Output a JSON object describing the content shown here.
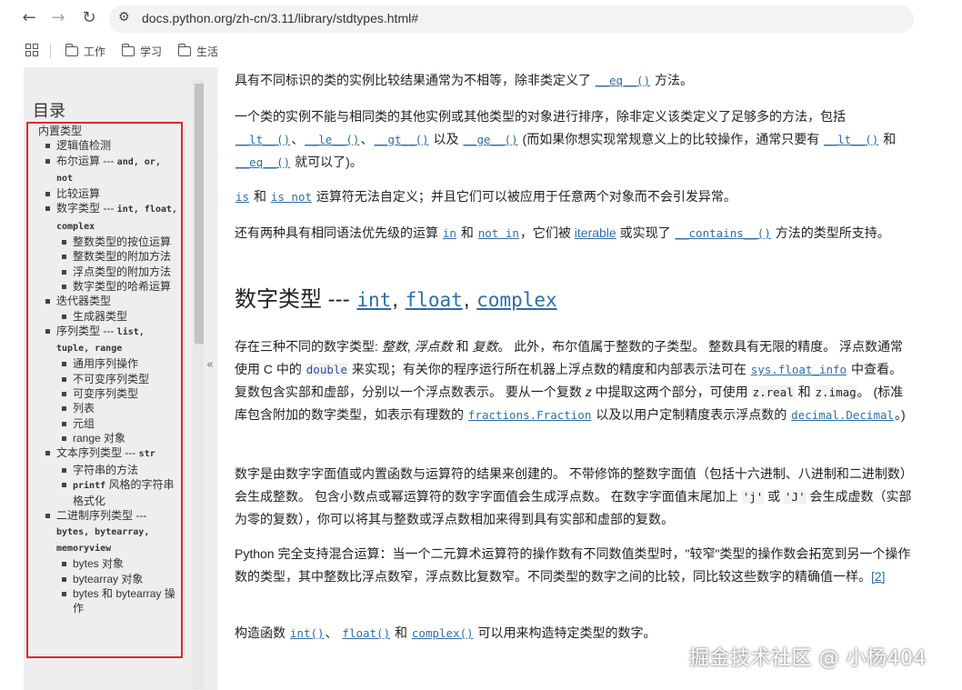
{
  "browser": {
    "back_icon": "←",
    "forward_icon": "→",
    "reload_icon": "↻",
    "url": "docs.python.org/zh-cn/3.11/library/stdtypes.html#",
    "bookmarks": [
      "工作",
      "学习",
      "生活"
    ]
  },
  "sidebar": {
    "title": "目录",
    "collapse_icon": "«",
    "toc": [
      {
        "level": 0,
        "text": "内置类型"
      },
      {
        "level": 1,
        "text": "逻辑值检测"
      },
      {
        "level": 1,
        "text": "布尔运算 --- ",
        "code": "and, or, not"
      },
      {
        "level": 1,
        "text": "比较运算"
      },
      {
        "level": 1,
        "text": "数字类型 --- ",
        "code": "int, float, complex"
      },
      {
        "level": 2,
        "text": "整数类型的按位运算"
      },
      {
        "level": 2,
        "text": "整数类型的附加方法"
      },
      {
        "level": 2,
        "text": "浮点类型的附加方法"
      },
      {
        "level": 2,
        "text": "数字类型的哈希运算"
      },
      {
        "level": 1,
        "text": "迭代器类型"
      },
      {
        "level": 2,
        "text": "生成器类型"
      },
      {
        "level": 1,
        "text": "序列类型 --- ",
        "code": "list, tuple, range"
      },
      {
        "level": 2,
        "text": "通用序列操作"
      },
      {
        "level": 2,
        "text": "不可变序列类型"
      },
      {
        "level": 2,
        "text": "可变序列类型"
      },
      {
        "level": 2,
        "text": "列表"
      },
      {
        "level": 2,
        "text": "元组"
      },
      {
        "level": 2,
        "text": "range 对象"
      },
      {
        "level": 1,
        "text": "文本序列类型 --- ",
        "code": "str"
      },
      {
        "level": 2,
        "text": "字符串的方法"
      },
      {
        "level": 2,
        "code_first": "printf",
        "text": " 风格的字符串格式化"
      },
      {
        "level": 1,
        "text": "二进制序列类型 --- ",
        "code": "bytes, bytearray, memoryview"
      },
      {
        "level": 2,
        "text": "bytes 对象"
      },
      {
        "level": 2,
        "text": "bytearray 对象"
      },
      {
        "level": 2,
        "text": "bytes 和 bytearray 操作"
      }
    ]
  },
  "content": {
    "p1": [
      "具有不同标识的类的实例比较结果通常为不相等，除非类定义了 ",
      "__eq__()",
      " 方法。"
    ],
    "p2": [
      "一个类的实例不能与相同类的其他实例或其他类型的对象进行排序，除非定义该类定义了足够多的方法，包括 ",
      "__lt__()",
      "、",
      "__le__()",
      "、",
      "__gt__()",
      " 以及 ",
      "__ge__()",
      " (而如果你想实现常规意义上的比较操作，通常只要有 ",
      "__lt__()",
      " 和 ",
      "__eq__()",
      " 就可以了)。"
    ],
    "p3": [
      "is",
      " 和 ",
      "is not",
      " 运算符无法自定义；并且它们可以被应用于任意两个对象而不会引发异常。"
    ],
    "p4": [
      "还有两种具有相同语法优先级的运算 ",
      "in",
      " 和 ",
      "not in",
      "，它们被 ",
      "iterable",
      " 或实现了 ",
      "__contains__()",
      " 方法的类型所支持。"
    ],
    "h2": [
      "数字类型 --- ",
      "int",
      ", ",
      "float",
      ", ",
      "complex"
    ],
    "p5": [
      "存在三种不同的数字类型: ",
      "整数",
      ", ",
      "浮点数",
      " 和 ",
      "复数",
      "。 此外，布尔值属于整数的子类型。 整数具有无限的精度。 浮点数通常使用 C 中的 ",
      "double",
      " 来实现；有关你的程序运行所在机器上浮点数的精度和内部表示法可在 ",
      "sys.float_info",
      " 中查看。 复数包含实部和虚部，分别以一个浮点数表示。 要从一个复数 ",
      "z",
      " 中提取这两个部分，可使用 ",
      "z.real",
      " 和 ",
      "z.imag",
      "。 (标准库包含附加的数字类型，如表示有理数的 ",
      "fractions.Fraction",
      " 以及以用户定制精度表示浮点数的 ",
      "decimal.Decimal",
      "。)"
    ],
    "p6": [
      "数字是由数字字面值或内置函数与运算符的结果来创建的。 不带修饰的整数字面值（包括十六进制、八进制和二进制数）会生成整数。 包含小数点或幂运算符的数字字面值会生成浮点数。 在数字字面值末尾加上 ",
      "'j'",
      " 或 ",
      "'J'",
      " 会生成虚数（实部为零的复数），你可以将其与整数或浮点数相加来得到具有实部和虚部的复数。"
    ],
    "p7": [
      "Python 完全支持混合运算：当一个二元算术运算符的操作数有不同数值类型时，\"较窄\"类型的操作数会拓宽到另一个操作数的类型，其中整数比浮点数窄，浮点数比复数窄。不同类型的数字之间的比较，同比较这些数字的精确值一样。",
      "[2]"
    ],
    "p8": [
      "构造函数 ",
      "int()",
      "、 ",
      "float()",
      " 和 ",
      "complex()",
      " 可以用来构造特定类型的数字。"
    ]
  },
  "watermark": "掘金技术社区 @ 小杨404"
}
